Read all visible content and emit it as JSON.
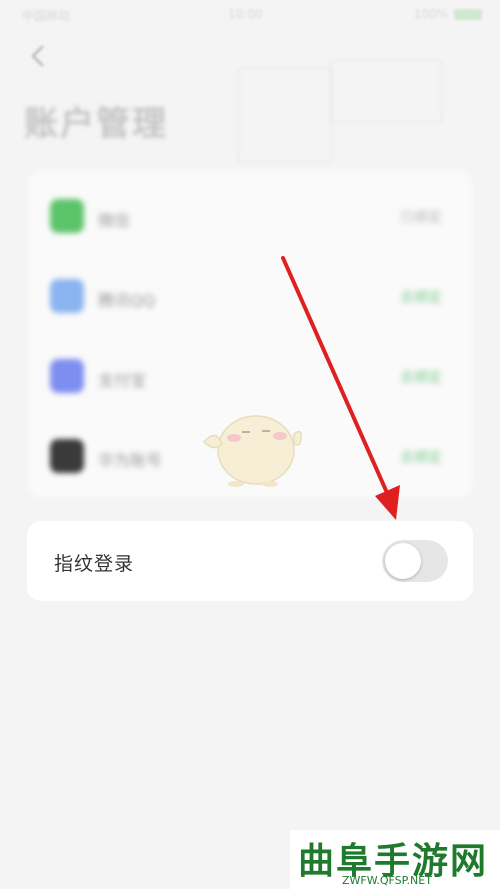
{
  "status_bar": {
    "left": "中国移动",
    "time": "10:00",
    "right": "100%"
  },
  "header": {
    "title": "账户管理"
  },
  "accounts": [
    {
      "name": "微信",
      "status": "已绑定",
      "status_color": "#b8b8b8",
      "icon_color": "#5cc46a"
    },
    {
      "name": "腾讯QQ",
      "status": "去绑定",
      "status_color": "#7dcc8f",
      "icon_color": "#8ab4f0"
    },
    {
      "name": "支付宝",
      "status": "去绑定",
      "status_color": "#7dcc8f",
      "icon_color": "#7e8ef0"
    },
    {
      "name": "华为账号",
      "status": "去绑定",
      "status_color": "#7dcc8f",
      "icon_color": "#3a3a3a"
    }
  ],
  "fingerprint": {
    "label": "指纹登录",
    "enabled": false
  },
  "watermark": {
    "title": "曲阜手游网",
    "url": "ZWFW.QFSP.NET"
  },
  "colors": {
    "annotation_arrow": "#e02020",
    "watermark_green": "#1f7a2e"
  }
}
